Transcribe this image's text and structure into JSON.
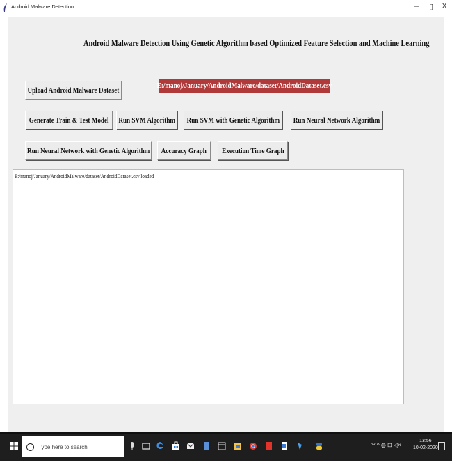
{
  "window": {
    "title": "Android Malware Detection",
    "controls": {
      "minimize": "–",
      "maximize": "▯",
      "close": "X"
    }
  },
  "app": {
    "heading": "Android Malware Detection Using Genetic Algorithm based Optimized Feature Selection and Machine Learning",
    "buttons": {
      "upload": "Upload Android Malware Dataset",
      "generate": "Generate Train & Test Model",
      "svm": "Run SVM Algorithm",
      "svm_ga": "Run SVM with Genetic Algorithm",
      "nn": "Run Neural Network Algorithm",
      "nn_ga": "Run Neural Network with Genetic Algorithm",
      "accuracy": "Accuracy Graph",
      "exec_time": "Execution Time Graph"
    },
    "dataset_path": "E:/manoj/January/AndroidMalware/dataset/AndroidDataset.csv",
    "output_text": "E:/manoj/January/AndroidMalware/dataset/AndroidDataset.csv loaded"
  },
  "taskbar": {
    "search_placeholder": "Type here to search",
    "tray_text": "ᵖᴿ ^ ◍ ⊡ ◁×",
    "time": "13:56",
    "date": "10-02-2020"
  },
  "colors": {
    "path_label_bg": "#b03a3a",
    "client_bg": "#efefef",
    "taskbar_bg": "#1e1e1e"
  }
}
